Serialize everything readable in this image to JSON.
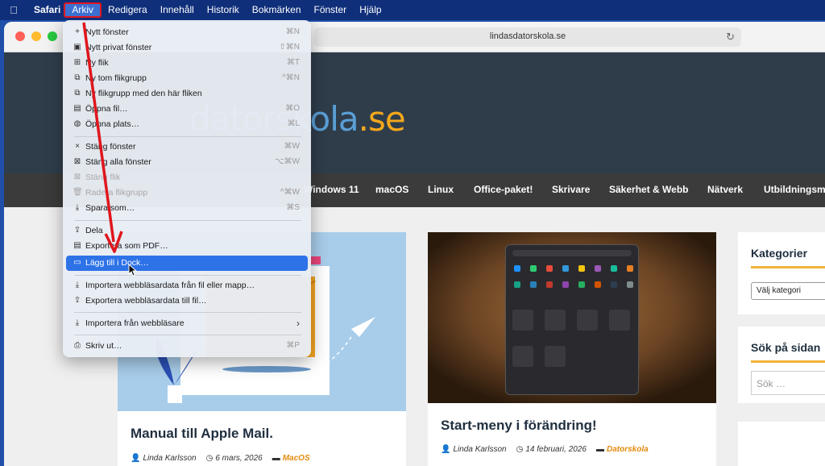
{
  "menubar": {
    "app": "Safari",
    "items": [
      "Arkiv",
      "Redigera",
      "Innehåll",
      "Historik",
      "Bokmärken",
      "Fönster",
      "Hjälp"
    ],
    "active": "Arkiv"
  },
  "browser": {
    "url": "lindasdatorskola.se"
  },
  "site": {
    "logo_main": "datorskola",
    "logo_tld": ".se",
    "nav": [
      "Windows 11",
      "macOS",
      "Linux",
      "Office-paket!",
      "Skrivare",
      "Säkerhet & Webb",
      "Nätverk",
      "Utbildningsma"
    ]
  },
  "menu": {
    "items": [
      {
        "icon": "+",
        "label": "Nytt fönster",
        "shortcut": "⌘N",
        "state": "normal"
      },
      {
        "icon": "▣",
        "label": "Nytt privat fönster",
        "shortcut": "⇧⌘N",
        "state": "normal"
      },
      {
        "icon": "⊞",
        "label": "Ny flik",
        "shortcut": "⌘T",
        "state": "normal"
      },
      {
        "icon": "⧉",
        "label": "Ny tom flikgrupp",
        "shortcut": "^⌘N",
        "state": "normal"
      },
      {
        "icon": "⧉",
        "label": "Ny flikgrupp med den här fliken",
        "shortcut": "",
        "state": "normal"
      },
      {
        "icon": "▤",
        "label": "Öppna fil…",
        "shortcut": "⌘O",
        "state": "normal"
      },
      {
        "icon": "◍",
        "label": "Öppna plats…",
        "shortcut": "⌘L",
        "state": "normal"
      },
      {
        "icon": "×",
        "label": "Stäng fönster",
        "shortcut": "⌘W",
        "state": "normal"
      },
      {
        "icon": "⊠",
        "label": "Stäng alla fönster",
        "shortcut": "⌥⌘W",
        "state": "normal"
      },
      {
        "icon": "⊠",
        "label": "Stäng flik",
        "shortcut": "",
        "state": "disabled"
      },
      {
        "icon": "🗑",
        "label": "Radera flikgrupp",
        "shortcut": "^⌘W",
        "state": "disabled"
      },
      {
        "icon": "⤓",
        "label": "Spara som…",
        "shortcut": "⌘S",
        "state": "normal"
      },
      {
        "icon": "⇪",
        "label": "Dela",
        "shortcut": "",
        "state": "normal"
      },
      {
        "icon": "▤",
        "label": "Exportera som PDF…",
        "shortcut": "",
        "state": "normal"
      },
      {
        "icon": "▭",
        "label": "Lägg till i Dock…",
        "shortcut": "",
        "state": "highlight"
      },
      {
        "icon": "⤓",
        "label": "Importera webbläsardata från fil eller mapp…",
        "shortcut": "",
        "state": "normal"
      },
      {
        "icon": "⇪",
        "label": "Exportera webbläsardata till fil…",
        "shortcut": "",
        "state": "normal"
      },
      {
        "icon": "⤓",
        "label": "Importera från webbläsare",
        "shortcut": "",
        "state": "submenu"
      },
      {
        "icon": "⎙",
        "label": "Skriv ut…",
        "shortcut": "⌘P",
        "state": "normal"
      }
    ]
  },
  "posts": [
    {
      "title": "Manual till Apple Mail.",
      "author": "Linda Karlsson",
      "date": "6 mars, 2026",
      "category": "MacOS"
    },
    {
      "title": "Start-meny i förändring!",
      "author": "Linda Karlsson",
      "date": "14 februari, 2026",
      "category": "Datorskola"
    }
  ],
  "sidebar": {
    "categories_title": "Kategorier",
    "categories_select": "Välj kategori",
    "search_title": "Sök på sidan",
    "search_placeholder": "Sök …"
  },
  "colors": {
    "highlight": "#2e72e8",
    "accent": "#f2b43a",
    "annotation": "#e0161d"
  }
}
